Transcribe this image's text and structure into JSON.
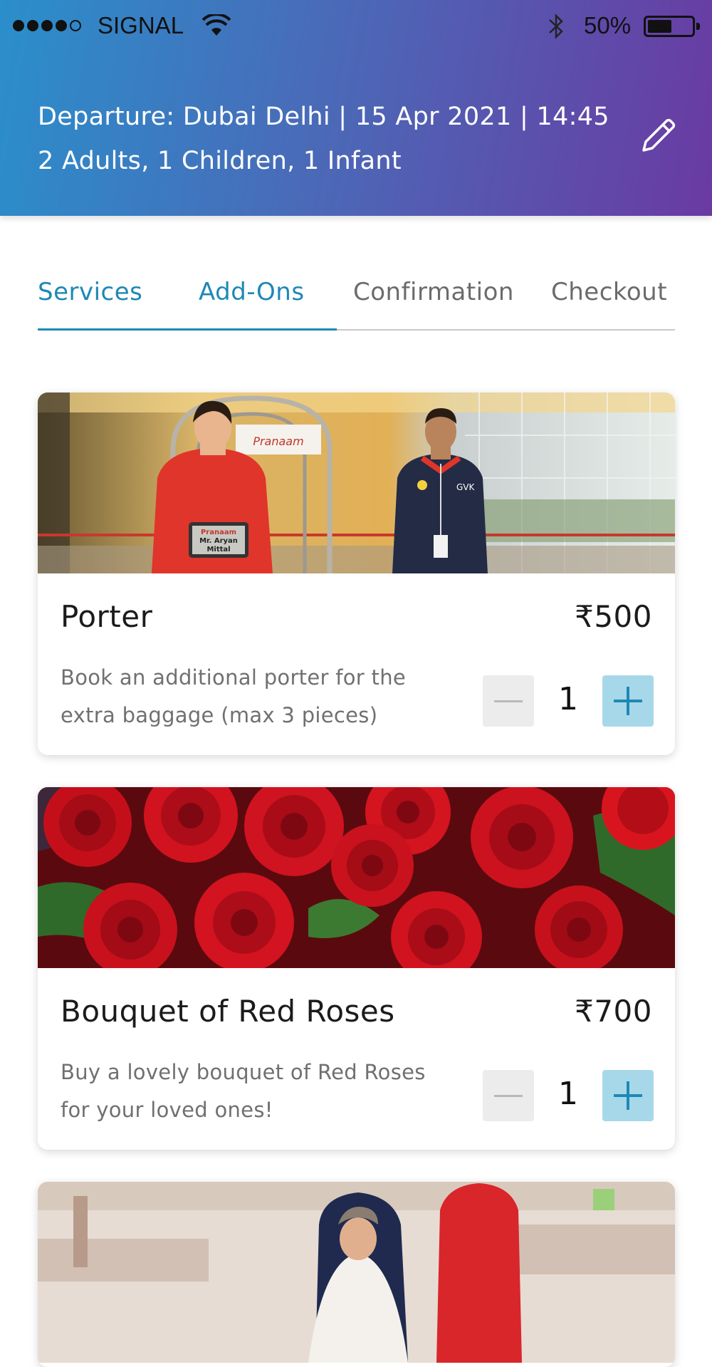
{
  "status_bar": {
    "carrier": "SIGNAL",
    "battery_percent": "50%",
    "battery_level": 0.5,
    "signal_bars": 4,
    "icons": [
      "wifi-icon",
      "bluetooth-icon",
      "battery-icon"
    ]
  },
  "trip": {
    "line1": "Departure: Dubai Delhi | 15 Apr 2021 | 14:45",
    "line2": "2 Adults, 1 Children, 1 Infant",
    "edit_icon": "pencil-icon"
  },
  "tabs": [
    {
      "label": "Services",
      "state": "active"
    },
    {
      "label": "Add-Ons",
      "state": "active"
    },
    {
      "label": "Confirmation",
      "state": "inactive"
    },
    {
      "label": "Checkout",
      "state": "inactive"
    }
  ],
  "colors": {
    "accent": "#1f88b5",
    "plus_button_bg": "#a7d8ea",
    "header_gradient_start": "#2a8fcb",
    "header_gradient_end": "#6a3aa2"
  },
  "addons": [
    {
      "title": "Porter",
      "price": "₹500",
      "description": "Book an additional porter for the extra baggage (max 3 pieces)",
      "quantity": "1",
      "image_sign_text": "Pranaam",
      "image_tablet_text": [
        "Pranaam",
        "Mr. Aryan",
        "Mittal"
      ],
      "image_badge_text": "GVK"
    },
    {
      "title": "Bouquet of Red Roses",
      "price": "₹700",
      "description": "Buy a lovely bouquet of Red Roses for your loved ones!",
      "quantity": "1"
    }
  ]
}
